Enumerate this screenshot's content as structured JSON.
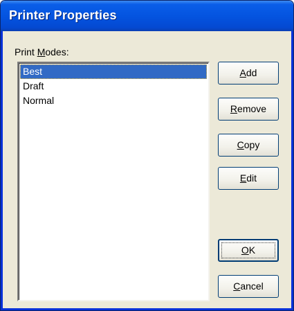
{
  "window": {
    "title": "Printer Properties"
  },
  "print_modes": {
    "label_prefix": "Print ",
    "label_accel": "M",
    "label_rest": "odes:",
    "items": [
      {
        "label": "Best",
        "selected": true
      },
      {
        "label": "Draft",
        "selected": false
      },
      {
        "label": "Normal",
        "selected": false
      }
    ]
  },
  "buttons": {
    "add": {
      "accel": "A",
      "rest": "dd"
    },
    "remove": {
      "accel": "R",
      "rest": "emove"
    },
    "copy": {
      "accel": "C",
      "rest": "opy"
    },
    "edit": {
      "accel": "E",
      "rest": "dit"
    },
    "ok": {
      "accel": "O",
      "rest": "K"
    },
    "cancel": {
      "accel": "C",
      "rest": "ancel"
    }
  },
  "colors": {
    "title_bar": "#0454e0",
    "selection": "#316ac5",
    "dialog_face": "#ece9d8"
  }
}
